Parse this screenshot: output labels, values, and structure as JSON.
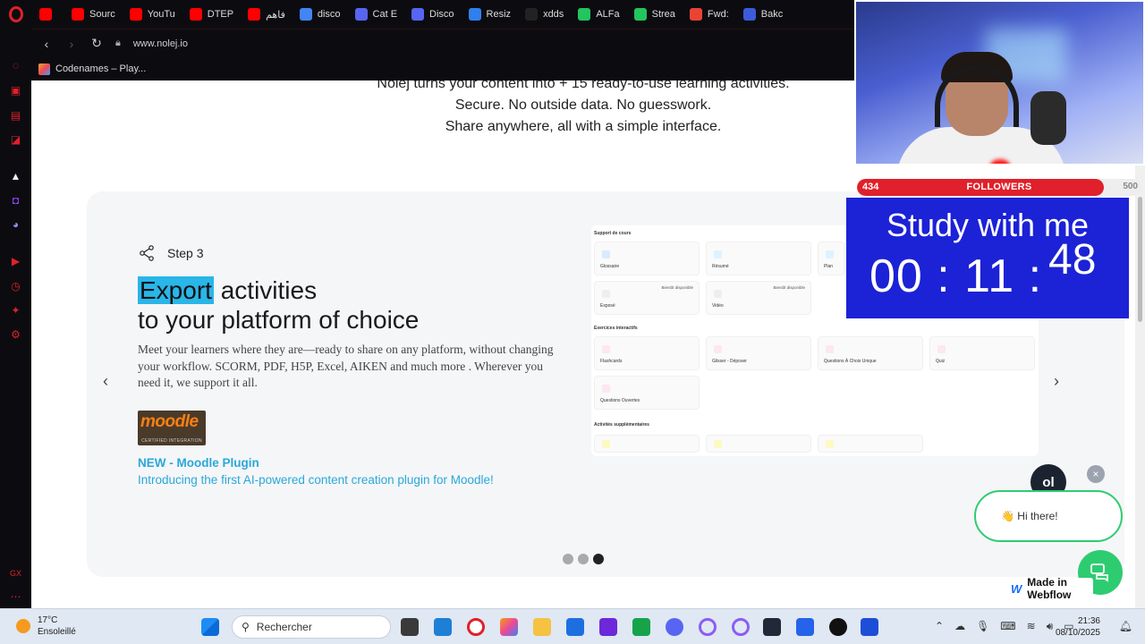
{
  "browser": {
    "tabs": [
      {
        "label": "",
        "color": "#ff0000"
      },
      {
        "label": "Sourc",
        "color": "#ff0000"
      },
      {
        "label": "YouTu",
        "color": "#ff0000"
      },
      {
        "label": "DTEP",
        "color": "#ff0000"
      },
      {
        "label": "فاهم",
        "color": "#ff0000"
      },
      {
        "label": "disco",
        "color": "#4285f4"
      },
      {
        "label": "Cat E",
        "color": "#5865f2"
      },
      {
        "label": "Disco",
        "color": "#5865f2"
      },
      {
        "label": "Resiz",
        "color": "#2f80ed"
      },
      {
        "label": "xdds",
        "color": "#222222"
      },
      {
        "label": "ALFa",
        "color": "#22c55e"
      },
      {
        "label": "Strea",
        "color": "#22c55e"
      },
      {
        "label": "Fwd:",
        "color": "#ea4335"
      },
      {
        "label": "Bakc",
        "color": "#3b5bdb"
      }
    ],
    "url": "www.nolej.io",
    "bookmark": "Codenames – Play..."
  },
  "page": {
    "intro_lines": [
      "Nolej turns your content into + 15 ready-to-use learning activities.",
      "Secure. No outside data. No guesswork.",
      "Share anywhere, all with a simple interface."
    ],
    "step_label": "Step 3",
    "heading_highlight": "Export",
    "heading_rest": " activities",
    "heading_line2": "to your platform of choice",
    "description": "Meet your learners where they are—ready to share on any platform, without changing your workflow. SCORM, PDF, H5P, Excel, AIKEN and much more . Wherever you need it, we support it all.",
    "moodle_logo": "moodle",
    "moodle_cert": "CERTIFIED INTEGRATION",
    "new_plugin": "NEW - Moodle Plugin",
    "plugin_text": "Introducing the first AI-powered content creation plugin for Moodle!",
    "carousel_active": 3,
    "carousel_total": 3,
    "activities": {
      "section1": "Support de cours",
      "section2": "Exercices interactifs",
      "section3": "Activités supplémentaires",
      "badge": "Bientôt disponible",
      "tiles": [
        "Glossaire",
        "Résumé",
        "Plan",
        "Exposé",
        "Vidéo",
        "Flashcards",
        "Glisser - Déposer",
        "Questions À Choix Unique",
        "Quiz",
        "Questions Ouvertes"
      ]
    }
  },
  "stream": {
    "followers_current": "434",
    "followers_label": "FOLLOWERS",
    "followers_goal": "500",
    "followers_progress": 0.868,
    "timer_title": "Study with me",
    "timer_hm": "00 : 11 :",
    "timer_s": "48"
  },
  "chat": {
    "avatar": "ol",
    "greeting": "👋 Hi there!",
    "close": "×"
  },
  "webflow_badge": "Made in Webflow",
  "taskbar": {
    "temperature": "17°C",
    "condition": "Ensoleillé",
    "search_placeholder": "Rechercher",
    "time": "21:36",
    "date": "08/10/2025"
  }
}
